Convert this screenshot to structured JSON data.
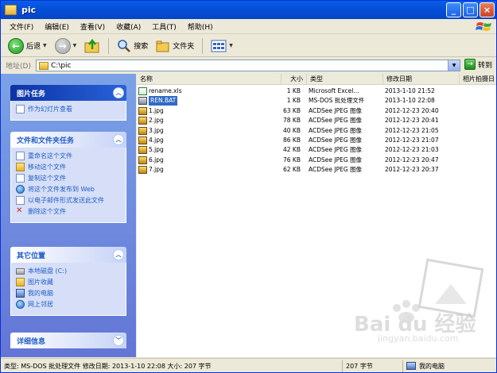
{
  "window": {
    "title": "pic"
  },
  "menu": {
    "items": [
      "文件(F)",
      "编辑(E)",
      "查看(V)",
      "收藏(A)",
      "工具(T)",
      "帮助(H)"
    ]
  },
  "toolbar": {
    "back_label": "后退",
    "search_label": "搜索",
    "folders_label": "文件夹"
  },
  "address": {
    "label": "地址(D)",
    "value": "C:\\pic",
    "go_label": "转到"
  },
  "sidebar": {
    "picture_tasks": {
      "title": "图片任务",
      "items": [
        "作为幻灯片查看"
      ]
    },
    "file_tasks": {
      "title": "文件和文件夹任务",
      "items": [
        "重命名这个文件",
        "移动这个文件",
        "复制这个文件",
        "将这个文件发布到 Web",
        "以电子邮件形式发送此文件",
        "删除这个文件"
      ]
    },
    "other_places": {
      "title": "其它位置",
      "items": [
        "本地磁盘 (C:)",
        "图片收藏",
        "我的电脑",
        "网上邻居"
      ]
    },
    "details": {
      "title": "详细信息"
    }
  },
  "columns": {
    "name": "名称",
    "size": "大小",
    "type": "类型",
    "modified": "修改日期",
    "extra": "相片拍摄日"
  },
  "files": [
    {
      "name": "rename.xls",
      "size": "1 KB",
      "type": "Microsoft Excel...",
      "date": "2013-1-10 21:52",
      "icon": "excel-icon",
      "selected": false
    },
    {
      "name": "REN.BAT",
      "size": "1 KB",
      "type": "MS-DOS 批处理文件",
      "date": "2013-1-10 22:08",
      "icon": "batch-file-icon",
      "selected": true
    },
    {
      "name": "1.jpg",
      "size": "63 KB",
      "type": "ACDSee JPEG 图像",
      "date": "2012-12-23 20:40",
      "icon": "jpeg-icon",
      "selected": false
    },
    {
      "name": "2.jpg",
      "size": "78 KB",
      "type": "ACDSee JPEG 图像",
      "date": "2012-12-23 20:41",
      "icon": "jpeg-icon",
      "selected": false
    },
    {
      "name": "3.jpg",
      "size": "40 KB",
      "type": "ACDSee JPEG 图像",
      "date": "2012-12-23 21:05",
      "icon": "jpeg-icon",
      "selected": false
    },
    {
      "name": "4.jpg",
      "size": "86 KB",
      "type": "ACDSee JPEG 图像",
      "date": "2012-12-23 21:07",
      "icon": "jpeg-icon",
      "selected": false
    },
    {
      "name": "5.jpg",
      "size": "42 KB",
      "type": "ACDSee JPEG 图像",
      "date": "2012-12-23 21:03",
      "icon": "jpeg-icon",
      "selected": false
    },
    {
      "name": "6.jpg",
      "size": "76 KB",
      "type": "ACDSee JPEG 图像",
      "date": "2012-12-23 20:47",
      "icon": "jpeg-icon",
      "selected": false
    },
    {
      "name": "7.jpg",
      "size": "62 KB",
      "type": "ACDSee JPEG 图像",
      "date": "2012-12-23 20:37",
      "icon": "jpeg-icon",
      "selected": false
    }
  ],
  "status": {
    "left": "类型: MS-DOS 批处理文件 修改日期: 2013-1-10 22:08 大小: 207 字节",
    "size": "207 字节",
    "location": "我的电脑"
  },
  "watermark": {
    "brand": "Bai du 经验",
    "url": "jingyan.baidu.com"
  },
  "colors": {
    "titlebar": "#0550D9",
    "sidebar": "#6F8EE0",
    "link": "#215DC6",
    "selection": "#316AC5"
  }
}
